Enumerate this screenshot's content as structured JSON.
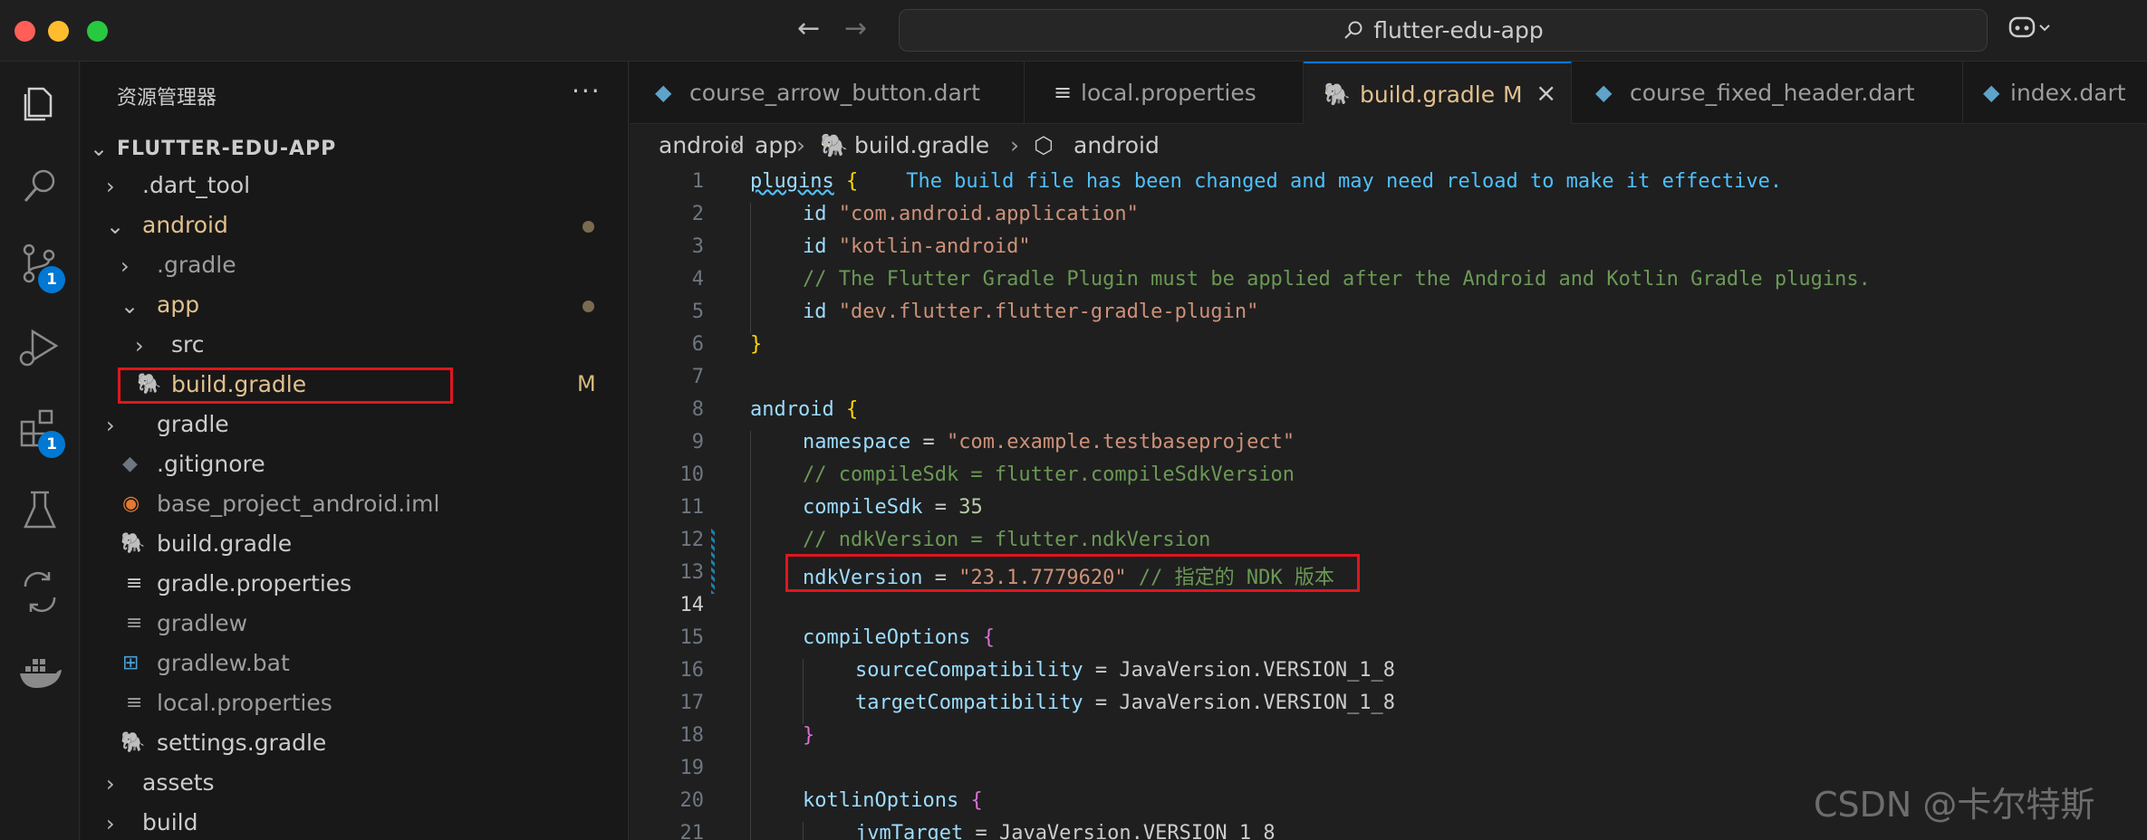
{
  "window": {
    "search_text": "flutter-edu-app"
  },
  "sidebar": {
    "title": "资源管理器",
    "more": "···",
    "root": "FLUTTER-EDU-APP",
    "items": [
      {
        "label": ".dart_tool",
        "chevron": "›"
      },
      {
        "label": "android",
        "chevron": "⌄"
      },
      {
        "label": ".gradle",
        "chevron": "›"
      },
      {
        "label": "app",
        "chevron": "⌄"
      },
      {
        "label": "src",
        "chevron": "›"
      },
      {
        "label": "build.gradle",
        "status": "M"
      },
      {
        "label": "gradle",
        "chevron": "›"
      },
      {
        "label": ".gitignore"
      },
      {
        "label": "base_project_android.iml"
      },
      {
        "label": "build.gradle"
      },
      {
        "label": "gradle.properties"
      },
      {
        "label": "gradlew"
      },
      {
        "label": "gradlew.bat"
      },
      {
        "label": "local.properties"
      },
      {
        "label": "settings.gradle"
      },
      {
        "label": "assets",
        "chevron": "›"
      },
      {
        "label": "build",
        "chevron": "›"
      }
    ]
  },
  "activity": {
    "source_control_badge": "1",
    "extensions_badge": "1",
    "braces": "{...}"
  },
  "tabs": [
    {
      "label": "course_arrow_button.dart"
    },
    {
      "label": "local.properties"
    },
    {
      "label": "build.gradle",
      "status": "M",
      "close": "×"
    },
    {
      "label": "course_fixed_header.dart"
    },
    {
      "label": "index.dart"
    }
  ],
  "breadcrumb": {
    "items": [
      "android",
      "app",
      "build.gradle",
      "android"
    ],
    "sep": "›"
  },
  "editor": {
    "line_numbers": [
      "1",
      "2",
      "3",
      "4",
      "5",
      "6",
      "7",
      "8",
      "9",
      "10",
      "11",
      "12",
      "13",
      "14",
      "15",
      "16",
      "17",
      "18",
      "19",
      "20",
      "21"
    ],
    "l1_kw": "plugins",
    "l1_brace": "{",
    "l1_info": "The build file has been changed and may need reload to make it effective.",
    "l2_kw": "id",
    "l2_str": "\"com.android.application\"",
    "l3_kw": "id",
    "l3_str": "\"kotlin-android\"",
    "l4_cm": "// The Flutter Gradle Plugin must be applied after the Android and Kotlin Gradle plugins.",
    "l5_kw": "id",
    "l5_str": "\"dev.flutter.flutter-gradle-plugin\"",
    "l6_brace": "}",
    "l8_kw": "android",
    "l8_brace": "{",
    "l9_kw": "namespace",
    "l9_eq": " = ",
    "l9_str": "\"com.example.testbaseproject\"",
    "l10_cm": "// compileSdk = flutter.compileSdkVersion",
    "l11_kw": "compileSdk",
    "l11_eq": " = ",
    "l11_num": "35",
    "l12_cm": "// ndkVersion = flutter.ndkVersion",
    "l13_kw": "ndkVersion",
    "l13_eq": " = ",
    "l13_str": "\"23.1.7779620\"",
    "l13_cm": " // 指定的 NDK 版本",
    "l15_kw": "compileOptions",
    "l15_brace": "{",
    "l16_kw": "sourceCompatibility",
    "l16_rest": " = JavaVersion.VERSION_1_8",
    "l17_kw": "targetCompatibility",
    "l17_rest": " = JavaVersion.VERSION_1_8",
    "l18_brace": "}",
    "l20_kw": "kotlinOptions",
    "l20_brace": "{",
    "l21_kw": "jvmTarget",
    "l21_rest": " = JavaVersion.VERSION_1_8"
  },
  "watermark": "CSDN @卡尔特斯",
  "colors": {
    "accent": "#0078d4",
    "highlight_box": "#e0161e",
    "modified": "#e2c08d"
  }
}
